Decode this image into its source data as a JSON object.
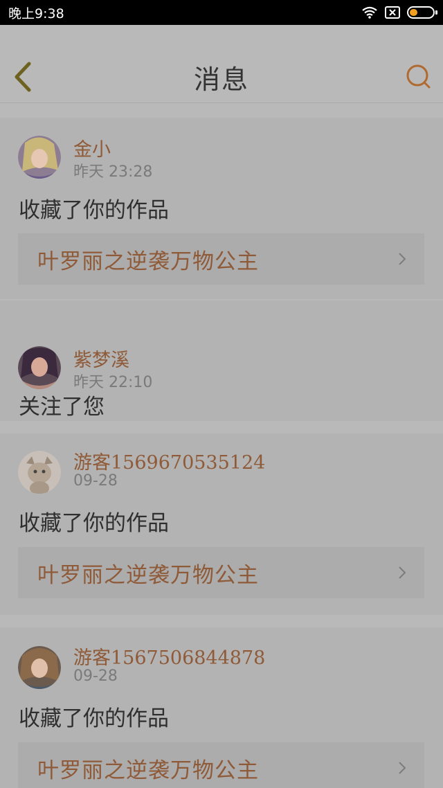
{
  "status_bar": {
    "time": "晚上9:38",
    "icons": [
      "wifi-icon",
      "sim-off-icon",
      "battery-icon"
    ],
    "battery_level": 0.3
  },
  "header": {
    "title": "消息",
    "back_icon": "chevron-left-icon",
    "search_icon": "search-icon"
  },
  "colors": {
    "accent": "#8f5a38",
    "nav_icon_back": "#7a6a20",
    "nav_icon_search": "#b46a2a"
  },
  "messages": [
    {
      "username": "金小",
      "time": "昨天 23:28",
      "action": "收藏了你的作品",
      "work_title": "叶罗丽之逆袭万物公主"
    },
    {
      "username": "紫梦溪",
      "time": "昨天 22:10",
      "action": "关注了您",
      "work_title": ""
    },
    {
      "username": "游客1569670535124",
      "time": "09-28",
      "action": "收藏了你的作品",
      "work_title": "叶罗丽之逆袭万物公主"
    },
    {
      "username": "游客1567506844878",
      "time": "09-28",
      "action": "收藏了你的作品",
      "work_title": "叶罗丽之逆袭万物公主"
    }
  ]
}
